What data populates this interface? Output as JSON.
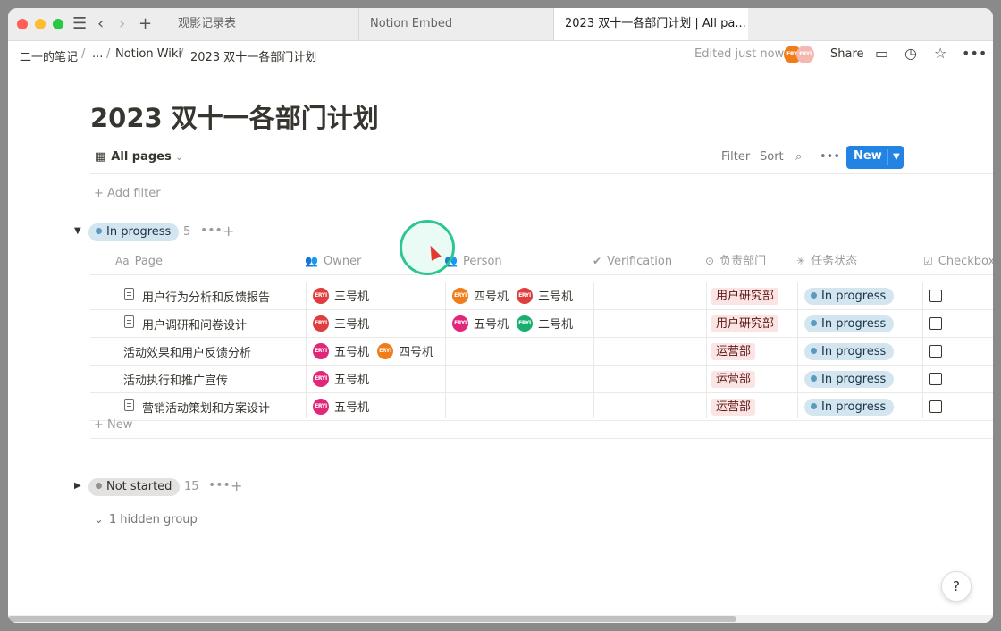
{
  "tabs": [
    {
      "label": "观影记录表",
      "active": false
    },
    {
      "label": "Notion Embed",
      "active": false
    },
    {
      "label": "2023 双十一各部门计划 | All pa...",
      "active": true
    }
  ],
  "breadcrumb": [
    "二一的笔记",
    "...",
    "Notion Wiki",
    "2023 双十一各部门计划"
  ],
  "topbar": {
    "edited": "Edited just now",
    "share": "Share",
    "avatar_text": "ERYI"
  },
  "page": {
    "title": "2023 双十一各部门计划"
  },
  "view": {
    "name": "All pages",
    "filter": "Filter",
    "sort": "Sort",
    "new_label": "New",
    "add_filter": "Add filter"
  },
  "groups": {
    "in_progress": {
      "label": "In progress",
      "count": "5"
    },
    "not_started": {
      "label": "Not started",
      "count": "15"
    },
    "hidden": "1 hidden group"
  },
  "columns": [
    "Page",
    "Owner",
    "Person",
    "Verification",
    "负责部门",
    "任务状态",
    "Checkbox"
  ],
  "rows": [
    {
      "page": "用户行为分析和反馈报告",
      "doc": true,
      "owners": [
        {
          "name": "三号机",
          "color": "#e03e3e"
        }
      ],
      "persons": [
        {
          "name": "四号机",
          "color": "#f07c1a"
        },
        {
          "name": "三号机",
          "color": "#e03e3e"
        }
      ],
      "dept": "用户研究部",
      "status": "In progress"
    },
    {
      "page": "用户调研和问卷设计",
      "doc": true,
      "owners": [
        {
          "name": "三号机",
          "color": "#e03e3e"
        }
      ],
      "persons": [
        {
          "name": "五号机",
          "color": "#e0277a"
        },
        {
          "name": "二号机",
          "color": "#1aaf6e"
        }
      ],
      "dept": "用户研究部",
      "status": "In progress"
    },
    {
      "page": "活动效果和用户反馈分析",
      "doc": false,
      "owners": [
        {
          "name": "五号机",
          "color": "#e0277a"
        },
        {
          "name": "四号机",
          "color": "#f07c1a"
        }
      ],
      "persons": [],
      "dept": "运营部",
      "status": "In progress"
    },
    {
      "page": "活动执行和推广宣传",
      "doc": false,
      "owners": [
        {
          "name": "五号机",
          "color": "#e0277a"
        }
      ],
      "persons": [],
      "dept": "运营部",
      "status": "In progress"
    },
    {
      "page": "营销活动策划和方案设计",
      "doc": true,
      "owners": [
        {
          "name": "五号机",
          "color": "#e0277a"
        }
      ],
      "persons": [],
      "dept": "运营部",
      "status": "In progress"
    }
  ],
  "new_row": "New",
  "help": "?"
}
